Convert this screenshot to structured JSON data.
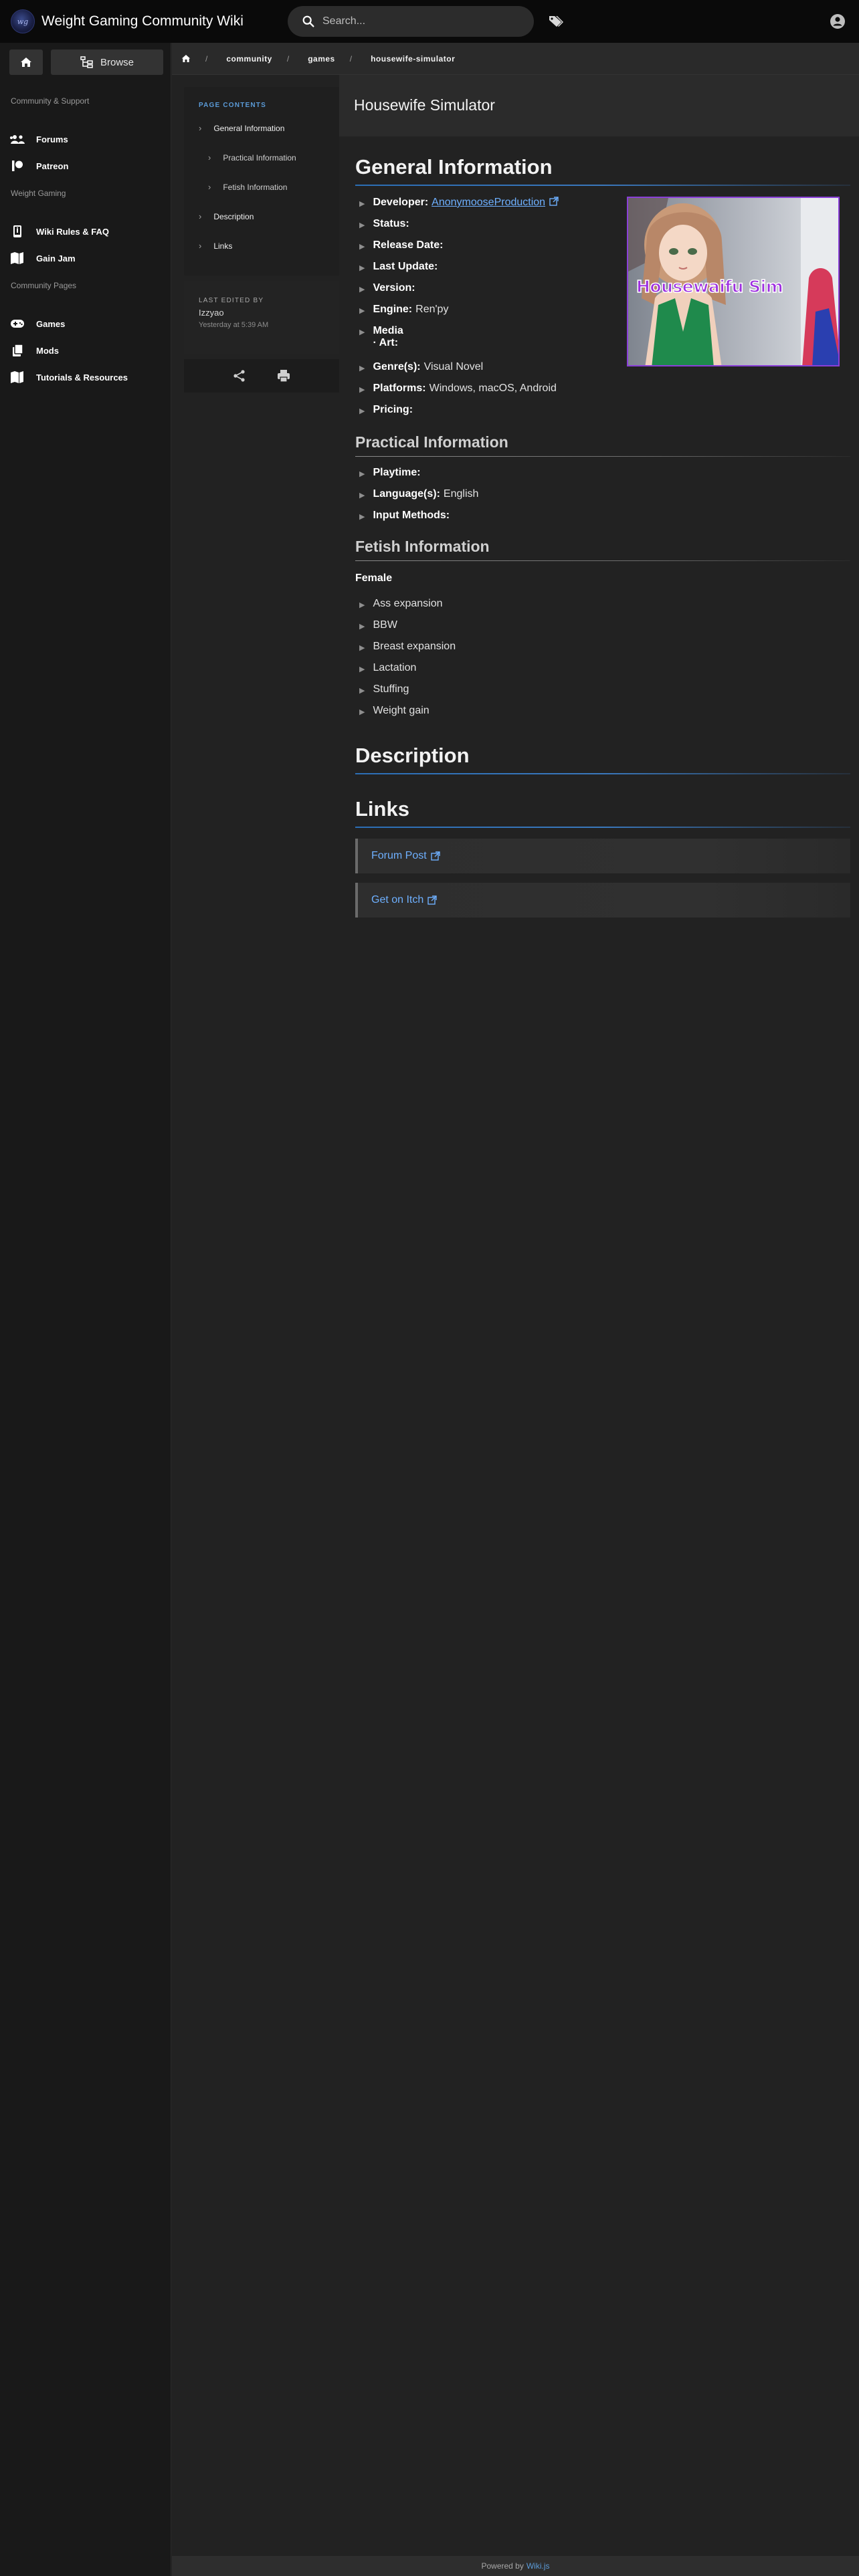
{
  "header": {
    "site_title": "Weight Gaming Community Wiki",
    "search_placeholder": "Search..."
  },
  "nav": {
    "browse_label": "Browse",
    "sections": [
      {
        "header": "Community & Support",
        "items": [
          "Forums",
          "Patreon"
        ]
      },
      {
        "header": "Weight Gaming",
        "items": [
          "Wiki Rules & FAQ",
          "Gain Jam"
        ]
      },
      {
        "header": "Community Pages",
        "items": [
          "Games",
          "Mods",
          "Tutorials & Resources"
        ]
      }
    ]
  },
  "breadcrumb": [
    "community",
    "games",
    "housewife-simulator"
  ],
  "toc": {
    "heading": "PAGE CONTENTS",
    "items": [
      "General Information",
      "Practical Information",
      "Fetish Information",
      "Description",
      "Links"
    ]
  },
  "last_edited": {
    "heading": "LAST EDITED BY",
    "name": "Izzyao",
    "time": "Yesterday at 5:39 AM"
  },
  "page": {
    "title": "Housewife Simulator",
    "general": {
      "heading": "General Information",
      "developer_label": "Developer:",
      "developer_value": "AnonymooseProduction",
      "status_label": "Status:",
      "release_label": "Release Date:",
      "update_label": "Last Update:",
      "version_label": "Version:",
      "engine_label": "Engine:",
      "engine_value": "Ren'py",
      "media_label": "Media",
      "art_label": "· Art:",
      "genre_label": "Genre(s):",
      "genre_value": "Visual Novel",
      "platforms_label": "Platforms:",
      "platforms_value": "Windows, macOS, Android",
      "pricing_label": "Pricing:",
      "cover_caption": "Housewaifu Sim"
    },
    "practical": {
      "heading": "Practical Information",
      "playtime_label": "Playtime:",
      "language_label": "Language(s):",
      "language_value": "English",
      "input_label": "Input Methods:"
    },
    "fetish": {
      "heading": "Fetish Information",
      "subheading": "Female",
      "items": [
        "Ass expansion",
        "BBW",
        "Breast expansion",
        "Lactation",
        "Stuffing",
        "Weight gain"
      ]
    },
    "description": {
      "heading": "Description"
    },
    "links": {
      "heading": "Links",
      "items": [
        "Forum Post",
        "Get on Itch"
      ]
    }
  },
  "footer": {
    "powered_by": "Powered by",
    "engine": "Wiki.js"
  },
  "colors": {
    "accent": "#5b9bd8",
    "link": "#6eb0ff",
    "header_bg": "#0a0a0a",
    "cover_border": "#8a3fd8"
  }
}
